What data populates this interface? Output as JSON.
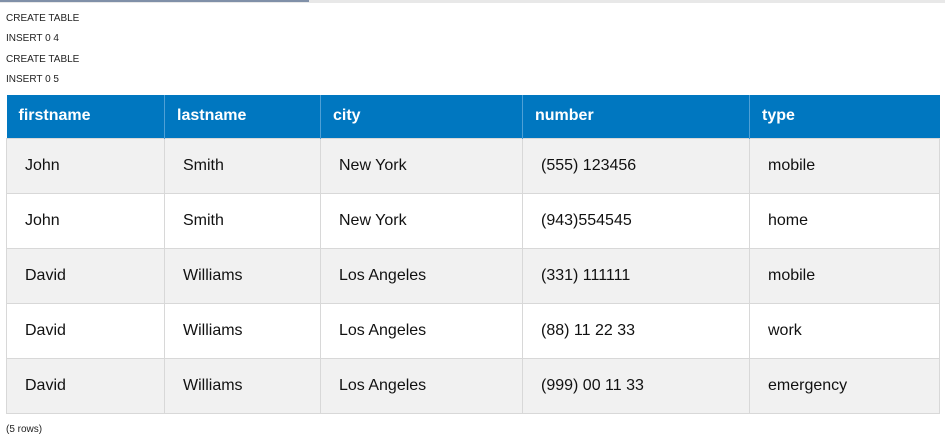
{
  "progress": {
    "fraction": 0.327
  },
  "log": [
    "CREATE TABLE",
    "INSERT 0 4",
    "CREATE TABLE",
    "INSERT 0 5"
  ],
  "table": {
    "headers": [
      "firstname",
      "lastname",
      "city",
      "number",
      "type"
    ],
    "rows": [
      [
        "John",
        "Smith",
        "New York",
        "(555) 123456",
        "mobile"
      ],
      [
        "John",
        "Smith",
        "New York",
        "(943)554545",
        "home"
      ],
      [
        "David",
        "Williams",
        "Los Angeles",
        "(331) 111111",
        "mobile"
      ],
      [
        "David",
        "Williams",
        "Los Angeles",
        "(88) 11 22 33",
        "work"
      ],
      [
        "David",
        "Williams",
        "Los Angeles",
        "(999) 00 11 33",
        "emergency"
      ]
    ]
  },
  "footer": "(5 rows)",
  "colors": {
    "header_bg": "#0077c0",
    "row_alt_bg": "#f1f1f1"
  }
}
